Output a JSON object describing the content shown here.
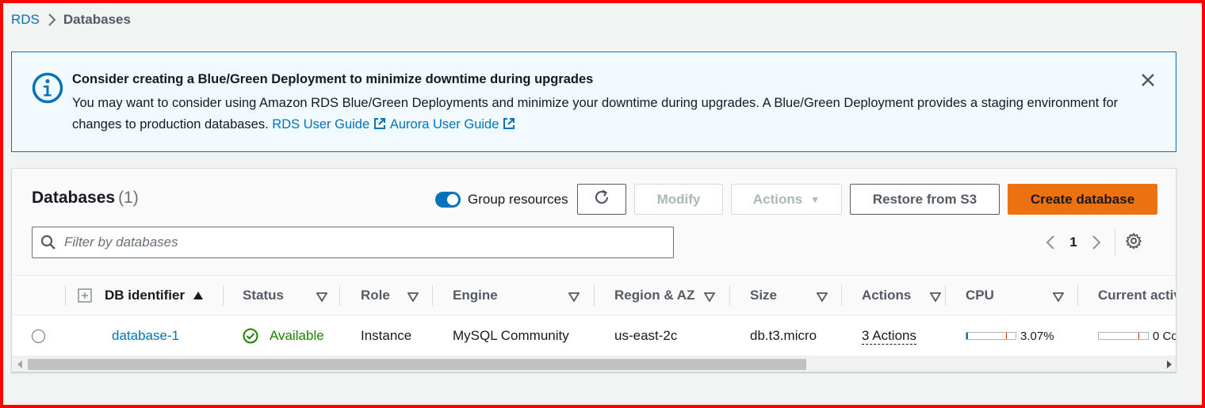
{
  "breadcrumb": {
    "root": "RDS",
    "current": "Databases"
  },
  "banner": {
    "title": "Consider creating a Blue/Green Deployment to minimize downtime during upgrades",
    "body": "You may want to consider using Amazon RDS Blue/Green Deployments and minimize your downtime during upgrades. A Blue/Green Deployment provides a staging environment for changes to production databases.",
    "link_rds": "RDS User Guide",
    "link_aurora": "Aurora User Guide"
  },
  "panel": {
    "title": "Databases",
    "count": "(1)",
    "group_resources_label": "Group resources",
    "group_resources_on": true,
    "buttons": {
      "modify": "Modify",
      "actions": "Actions",
      "restore": "Restore from S3",
      "create": "Create database"
    },
    "filter_placeholder": "Filter by databases",
    "page": "1"
  },
  "table": {
    "columns": [
      "DB identifier",
      "Status",
      "Role",
      "Engine",
      "Region & AZ",
      "Size",
      "Actions",
      "CPU",
      "Current activ"
    ],
    "rows": [
      {
        "db_identifier": "database-1",
        "status": "Available",
        "role": "Instance",
        "engine": "MySQL Community",
        "region_az": "us-east-2c",
        "size": "db.t3.micro",
        "actions": "3 Actions",
        "cpu": "3.07%",
        "cpu_fraction": 0.0307,
        "current_activity": "0 Co",
        "current_activity_fraction": 0
      }
    ]
  },
  "colors": {
    "link": "#0073bb",
    "primary_button": "#ec7211",
    "success": "#1d8102",
    "banner_bg": "#f1faff",
    "frame": "#ff0000"
  }
}
